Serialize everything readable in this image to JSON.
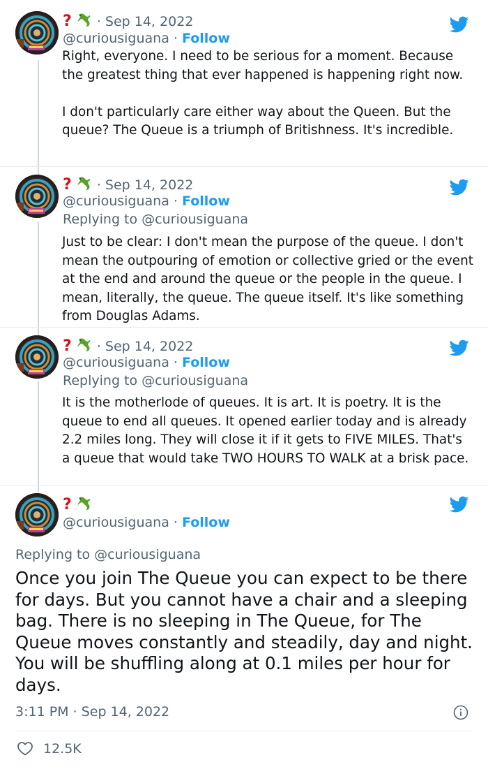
{
  "tweets": [
    {
      "name_mark": "?",
      "date": "Sep 14, 2022",
      "handle": "@curiousiguana",
      "follow": "Follow",
      "reply_prefix": "",
      "reply_handle": "",
      "paragraphs": [
        "Right, everyone. I need to be serious for a moment. Because the greatest thing that ever happened is happening right now.",
        "I don't particularly care either way about the Queen. But the queue? The Queue is a triumph of Britishness. It's incredible."
      ]
    },
    {
      "name_mark": "?",
      "date": "Sep 14, 2022",
      "handle": "@curiousiguana",
      "follow": "Follow",
      "reply_prefix": "Replying to",
      "reply_handle": "@curiousiguana",
      "paragraphs": [
        "Just to be clear: I don't mean the purpose of the queue. I don't mean the outpouring of emotion or collective gried or the event at the end and around the queue or the people in the queue. I mean, literally, the queue. The queue itself. It's like something from Douglas Adams."
      ]
    },
    {
      "name_mark": "?",
      "date": "Sep 14, 2022",
      "handle": "@curiousiguana",
      "follow": "Follow",
      "reply_prefix": "Replying to",
      "reply_handle": "@curiousiguana",
      "paragraphs": [
        "It is the motherlode of queues. It is art. It is poetry. It is the queue to end all queues. It opened earlier today and is already 2.2 miles long. They will close it if it gets to FIVE MILES. That's a queue that would take TWO HOURS TO WALK at a brisk pace."
      ]
    }
  ],
  "main_tweet": {
    "name_mark": "?",
    "handle": "@curiousiguana",
    "follow": "Follow",
    "reply_prefix": "Replying to",
    "reply_handle": "@curiousiguana",
    "text": "Once you join The Queue you can expect to be there for days. But you cannot have a chair and a sleeping bag. There is no sleeping in The Queue, for The Queue moves constantly and steadily, day and night. You will be shuffling along at 0.1 miles per hour for days.",
    "time": "3:11 PM",
    "date": "Sep 14, 2022",
    "likes": "12.5K"
  },
  "icons": {
    "bird": "twitter-bird-icon",
    "lizard": "lizard-emoji-icon",
    "info": "info-icon",
    "heart": "heart-icon"
  },
  "colors": {
    "accent": "#1d9bf0",
    "muted": "#536471",
    "text": "#0f1419",
    "question_mark": "#d0121e"
  }
}
